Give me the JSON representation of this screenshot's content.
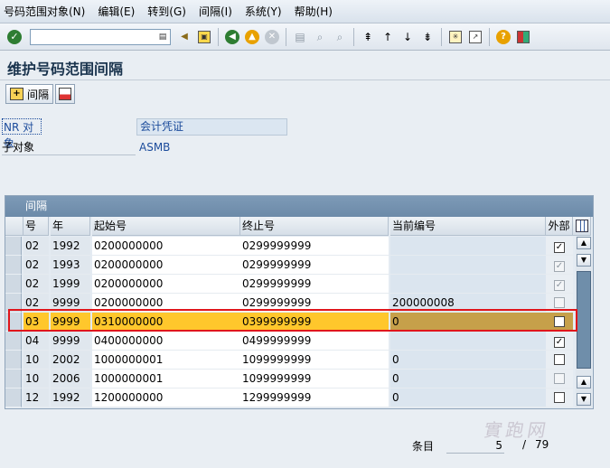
{
  "menubar": {
    "items": [
      "号码范围对象(N)",
      "编辑(E)",
      "转到(G)",
      "间隔(I)",
      "系统(Y)",
      "帮助(H)"
    ]
  },
  "toolbar": {
    "command_value": "",
    "icons": [
      "ok-icon",
      "save-icon",
      "back-icon",
      "exit-icon",
      "cancel-icon",
      "print-icon",
      "find-icon",
      "find-next-icon",
      "first-page-icon",
      "prev-page-icon",
      "next-page-icon",
      "last-page-icon",
      "create-session-icon",
      "shortcut-icon",
      "help-icon",
      "layout-icon"
    ]
  },
  "page": {
    "title": "维护号码范围间隔"
  },
  "app_toolbar": {
    "interval_button_label": "间隔"
  },
  "fields": {
    "nr_object_label": "NR 对象",
    "nr_object_value": "会计凭证",
    "subobject_label": "子对象",
    "subobject_value": "ASMB"
  },
  "table": {
    "title": "间隔",
    "headers": {
      "num": "号",
      "year": "年",
      "from": "起始号",
      "to": "终止号",
      "current": "当前编号",
      "ext": "外部"
    },
    "rows": [
      {
        "num": "02",
        "year": "1992",
        "from": "0200000000",
        "to": "0299999999",
        "current": "",
        "ext": true,
        "ext_disabled": false
      },
      {
        "num": "02",
        "year": "1993",
        "from": "0200000000",
        "to": "0299999999",
        "current": "",
        "ext": true,
        "ext_disabled": true
      },
      {
        "num": "02",
        "year": "1999",
        "from": "0200000000",
        "to": "0299999999",
        "current": "",
        "ext": true,
        "ext_disabled": true
      },
      {
        "num": "02",
        "year": "9999",
        "from": "0200000000",
        "to": "0299999999",
        "current": "200000008",
        "ext": false,
        "ext_disabled": true
      },
      {
        "num": "03",
        "year": "9999",
        "from": "0310000000",
        "to": "0399999999",
        "current": "0",
        "ext": false,
        "ext_disabled": false,
        "highlighted": true
      },
      {
        "num": "04",
        "year": "9999",
        "from": "0400000000",
        "to": "0499999999",
        "current": "",
        "ext": true,
        "ext_disabled": false
      },
      {
        "num": "10",
        "year": "2002",
        "from": "1000000001",
        "to": "1099999999",
        "current": "0",
        "ext": false,
        "ext_disabled": false
      },
      {
        "num": "10",
        "year": "2006",
        "from": "1000000001",
        "to": "1099999999",
        "current": "0",
        "ext": false,
        "ext_disabled": true
      },
      {
        "num": "12",
        "year": "1992",
        "from": "1200000000",
        "to": "1299999999",
        "current": "0",
        "ext": false,
        "ext_disabled": false
      }
    ]
  },
  "footer": {
    "entries_label": "条目",
    "entries_current": "5",
    "entries_sep": "/",
    "entries_total": "79"
  },
  "watermark": "實跑网",
  "colors": {
    "highlight_row": "#ffc72c",
    "highlight_border": "#e0151b",
    "table_header_bar": "#7d9ab7"
  }
}
